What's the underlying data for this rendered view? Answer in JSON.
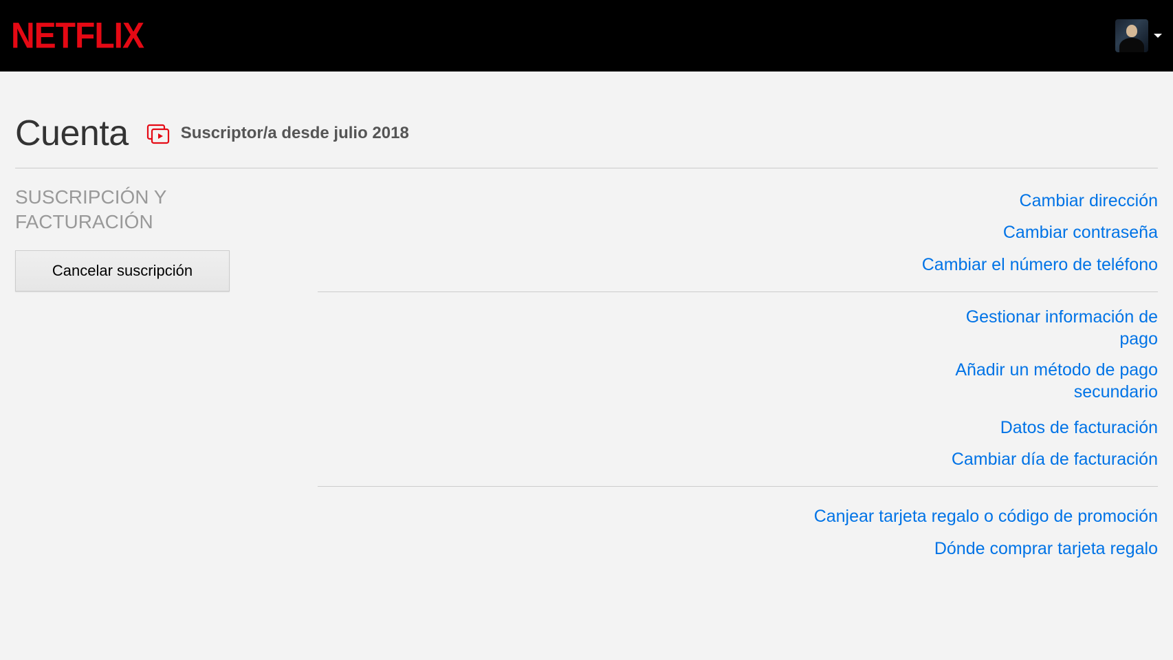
{
  "header": {
    "logo": "NETFLIX"
  },
  "page": {
    "title": "Cuenta",
    "member_since": "Suscriptor/a desde julio 2018"
  },
  "section": {
    "title": "SUSCRIPCIÓN Y FACTURACIÓN",
    "cancel_button": "Cancelar suscripción"
  },
  "links": {
    "group1": {
      "change_email": "Cambiar dirección",
      "change_password": "Cambiar contraseña",
      "change_phone": "Cambiar el número de teléfono"
    },
    "group2": {
      "manage_payment": "Gestionar información de pago",
      "add_backup_payment": "Añadir un método de pago secundario",
      "billing_details": "Datos de facturación",
      "change_billing_day": "Cambiar día de facturación"
    },
    "group3": {
      "redeem_gift": "Canjear tarjeta regalo o código de promoción",
      "where_buy_gift": "Dónde comprar tarjeta regalo"
    }
  }
}
